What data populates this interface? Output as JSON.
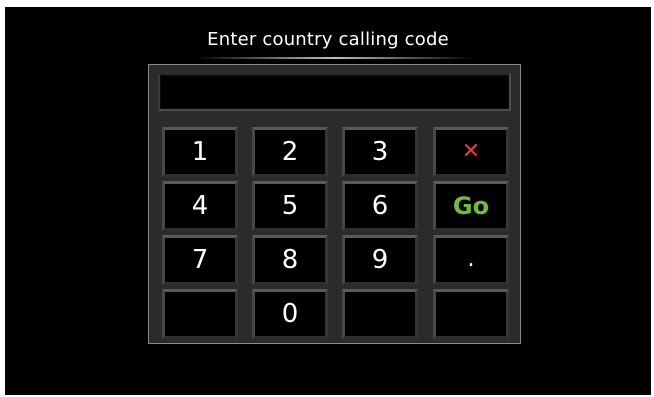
{
  "title": "Enter country calling code",
  "code_display": {
    "value": ""
  },
  "keypad": {
    "k1": "1",
    "k2": "2",
    "k3": "3",
    "clear": "✕",
    "k4": "4",
    "k5": "5",
    "k6": "6",
    "go": "Go",
    "k7": "7",
    "k8": "8",
    "k9": "9",
    "dot": ".",
    "k0": "0"
  },
  "colors": {
    "background": "#000000",
    "go": "#6fbd3c",
    "clear": "#e03a3a"
  }
}
